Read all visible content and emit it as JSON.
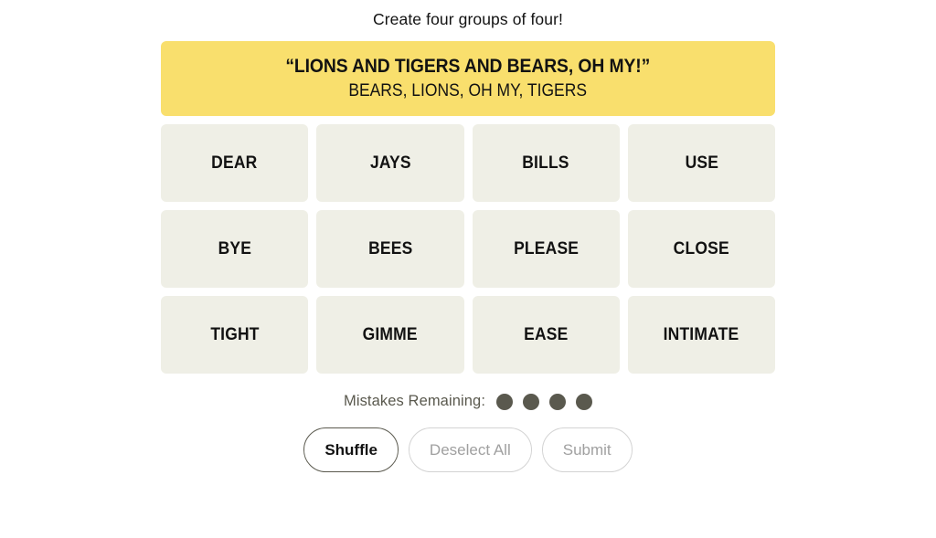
{
  "instruction": "Create four groups of four!",
  "solved_groups": [
    {
      "title": "“LIONS AND TIGERS AND BEARS, OH MY!”",
      "members": "BEARS, LIONS, OH MY, TIGERS",
      "color": "#f9df6d"
    }
  ],
  "grid": {
    "rows": [
      {
        "tiles": [
          {
            "label": "DEAR"
          },
          {
            "label": "JAYS"
          },
          {
            "label": "BILLS"
          },
          {
            "label": "USE"
          }
        ]
      },
      {
        "tiles": [
          {
            "label": "BYE"
          },
          {
            "label": "BEES"
          },
          {
            "label": "PLEASE"
          },
          {
            "label": "CLOSE"
          }
        ]
      },
      {
        "tiles": [
          {
            "label": "TIGHT"
          },
          {
            "label": "GIMME"
          },
          {
            "label": "EASE"
          },
          {
            "label": "INTIMATE"
          }
        ]
      }
    ],
    "tile_color": "#efefe6"
  },
  "mistakes": {
    "label": "Mistakes Remaining:",
    "remaining": 4,
    "dot_color": "#5a594e"
  },
  "buttons": {
    "shuffle": {
      "label": "Shuffle",
      "state": "enabled"
    },
    "deselect_all": {
      "label": "Deselect All",
      "state": "disabled"
    },
    "submit": {
      "label": "Submit",
      "state": "disabled"
    }
  }
}
